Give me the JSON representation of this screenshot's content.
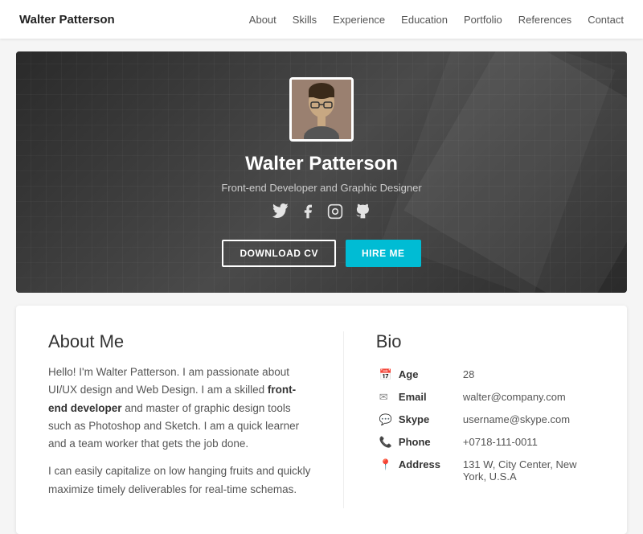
{
  "nav": {
    "logo": "Walter Patterson",
    "links": [
      "About",
      "Skills",
      "Experience",
      "Education",
      "Portfolio",
      "References",
      "Contact"
    ]
  },
  "hero": {
    "name": "Walter Patterson",
    "title": "Front-end Developer and Graphic Designer",
    "social_icons": [
      "twitter",
      "facebook",
      "instagram",
      "github"
    ],
    "btn_download": "DOWNLOAD CV",
    "btn_hire": "HIRE ME"
  },
  "about": {
    "title": "About Me",
    "paragraphs": [
      "Hello! I'm Walter Patterson. I am passionate about UI/UX design and Web Design. I am a skilled front-end developer and master of graphic design tools such as Photoshop and Sketch. I am a quick learner and a team worker that gets the job done.",
      "I can easily capitalize on low hanging fruits and quickly maximize timely deliverables for real-time schemas."
    ],
    "bold_phrase": "front-end developer"
  },
  "bio": {
    "title": "Bio",
    "fields": [
      {
        "icon": "📅",
        "label": "Age",
        "value": "28"
      },
      {
        "icon": "✉",
        "label": "Email",
        "value": "walter@company.com"
      },
      {
        "icon": "💬",
        "label": "Skype",
        "value": "username@skype.com"
      },
      {
        "icon": "📞",
        "label": "Phone",
        "value": "+0718-111-0011"
      },
      {
        "icon": "📍",
        "label": "Address",
        "value": "131 W, City Center, New York, U.S.A"
      }
    ]
  }
}
